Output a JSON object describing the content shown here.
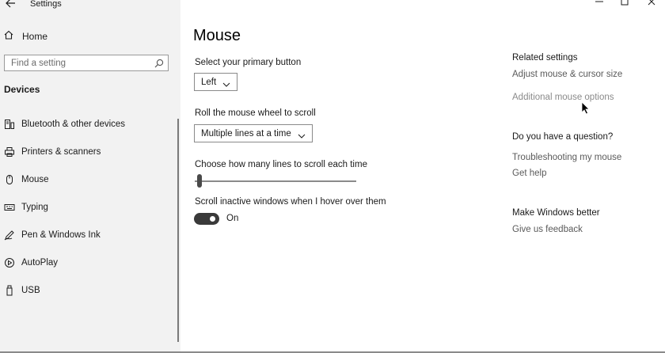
{
  "window": {
    "title": "Settings"
  },
  "sidebar": {
    "home_label": "Home",
    "search_placeholder": "Find a setting",
    "section_title": "Devices",
    "items": [
      {
        "label": "Bluetooth & other devices",
        "icon": "bluetooth-devices-icon"
      },
      {
        "label": "Printers & scanners",
        "icon": "printer-icon"
      },
      {
        "label": "Mouse",
        "icon": "mouse-icon"
      },
      {
        "label": "Typing",
        "icon": "keyboard-icon"
      },
      {
        "label": "Pen & Windows Ink",
        "icon": "pen-icon"
      },
      {
        "label": "AutoPlay",
        "icon": "autoplay-icon"
      },
      {
        "label": "USB",
        "icon": "usb-icon"
      }
    ]
  },
  "main": {
    "title": "Mouse",
    "primary_button": {
      "label": "Select your primary button",
      "value": "Left"
    },
    "scroll_mode": {
      "label": "Roll the mouse wheel to scroll",
      "value": "Multiple lines at a time"
    },
    "scroll_lines": {
      "label": "Choose how many lines to scroll each time",
      "level": 0.03
    },
    "inactive_scroll": {
      "label": "Scroll inactive windows when I hover over them",
      "state": "On"
    }
  },
  "related": {
    "heading": "Related settings",
    "links": [
      "Adjust mouse & cursor size",
      "Additional mouse options"
    ]
  },
  "question": {
    "heading": "Do you have a question?",
    "links": [
      "Troubleshooting my mouse",
      "Get help"
    ]
  },
  "feedback": {
    "heading": "Make Windows better",
    "link": "Give us feedback"
  },
  "colors": {
    "sidebar_bg": "#f2f2f2",
    "toggle_on": "#3a3a3a",
    "link": "#5a5a5a"
  }
}
